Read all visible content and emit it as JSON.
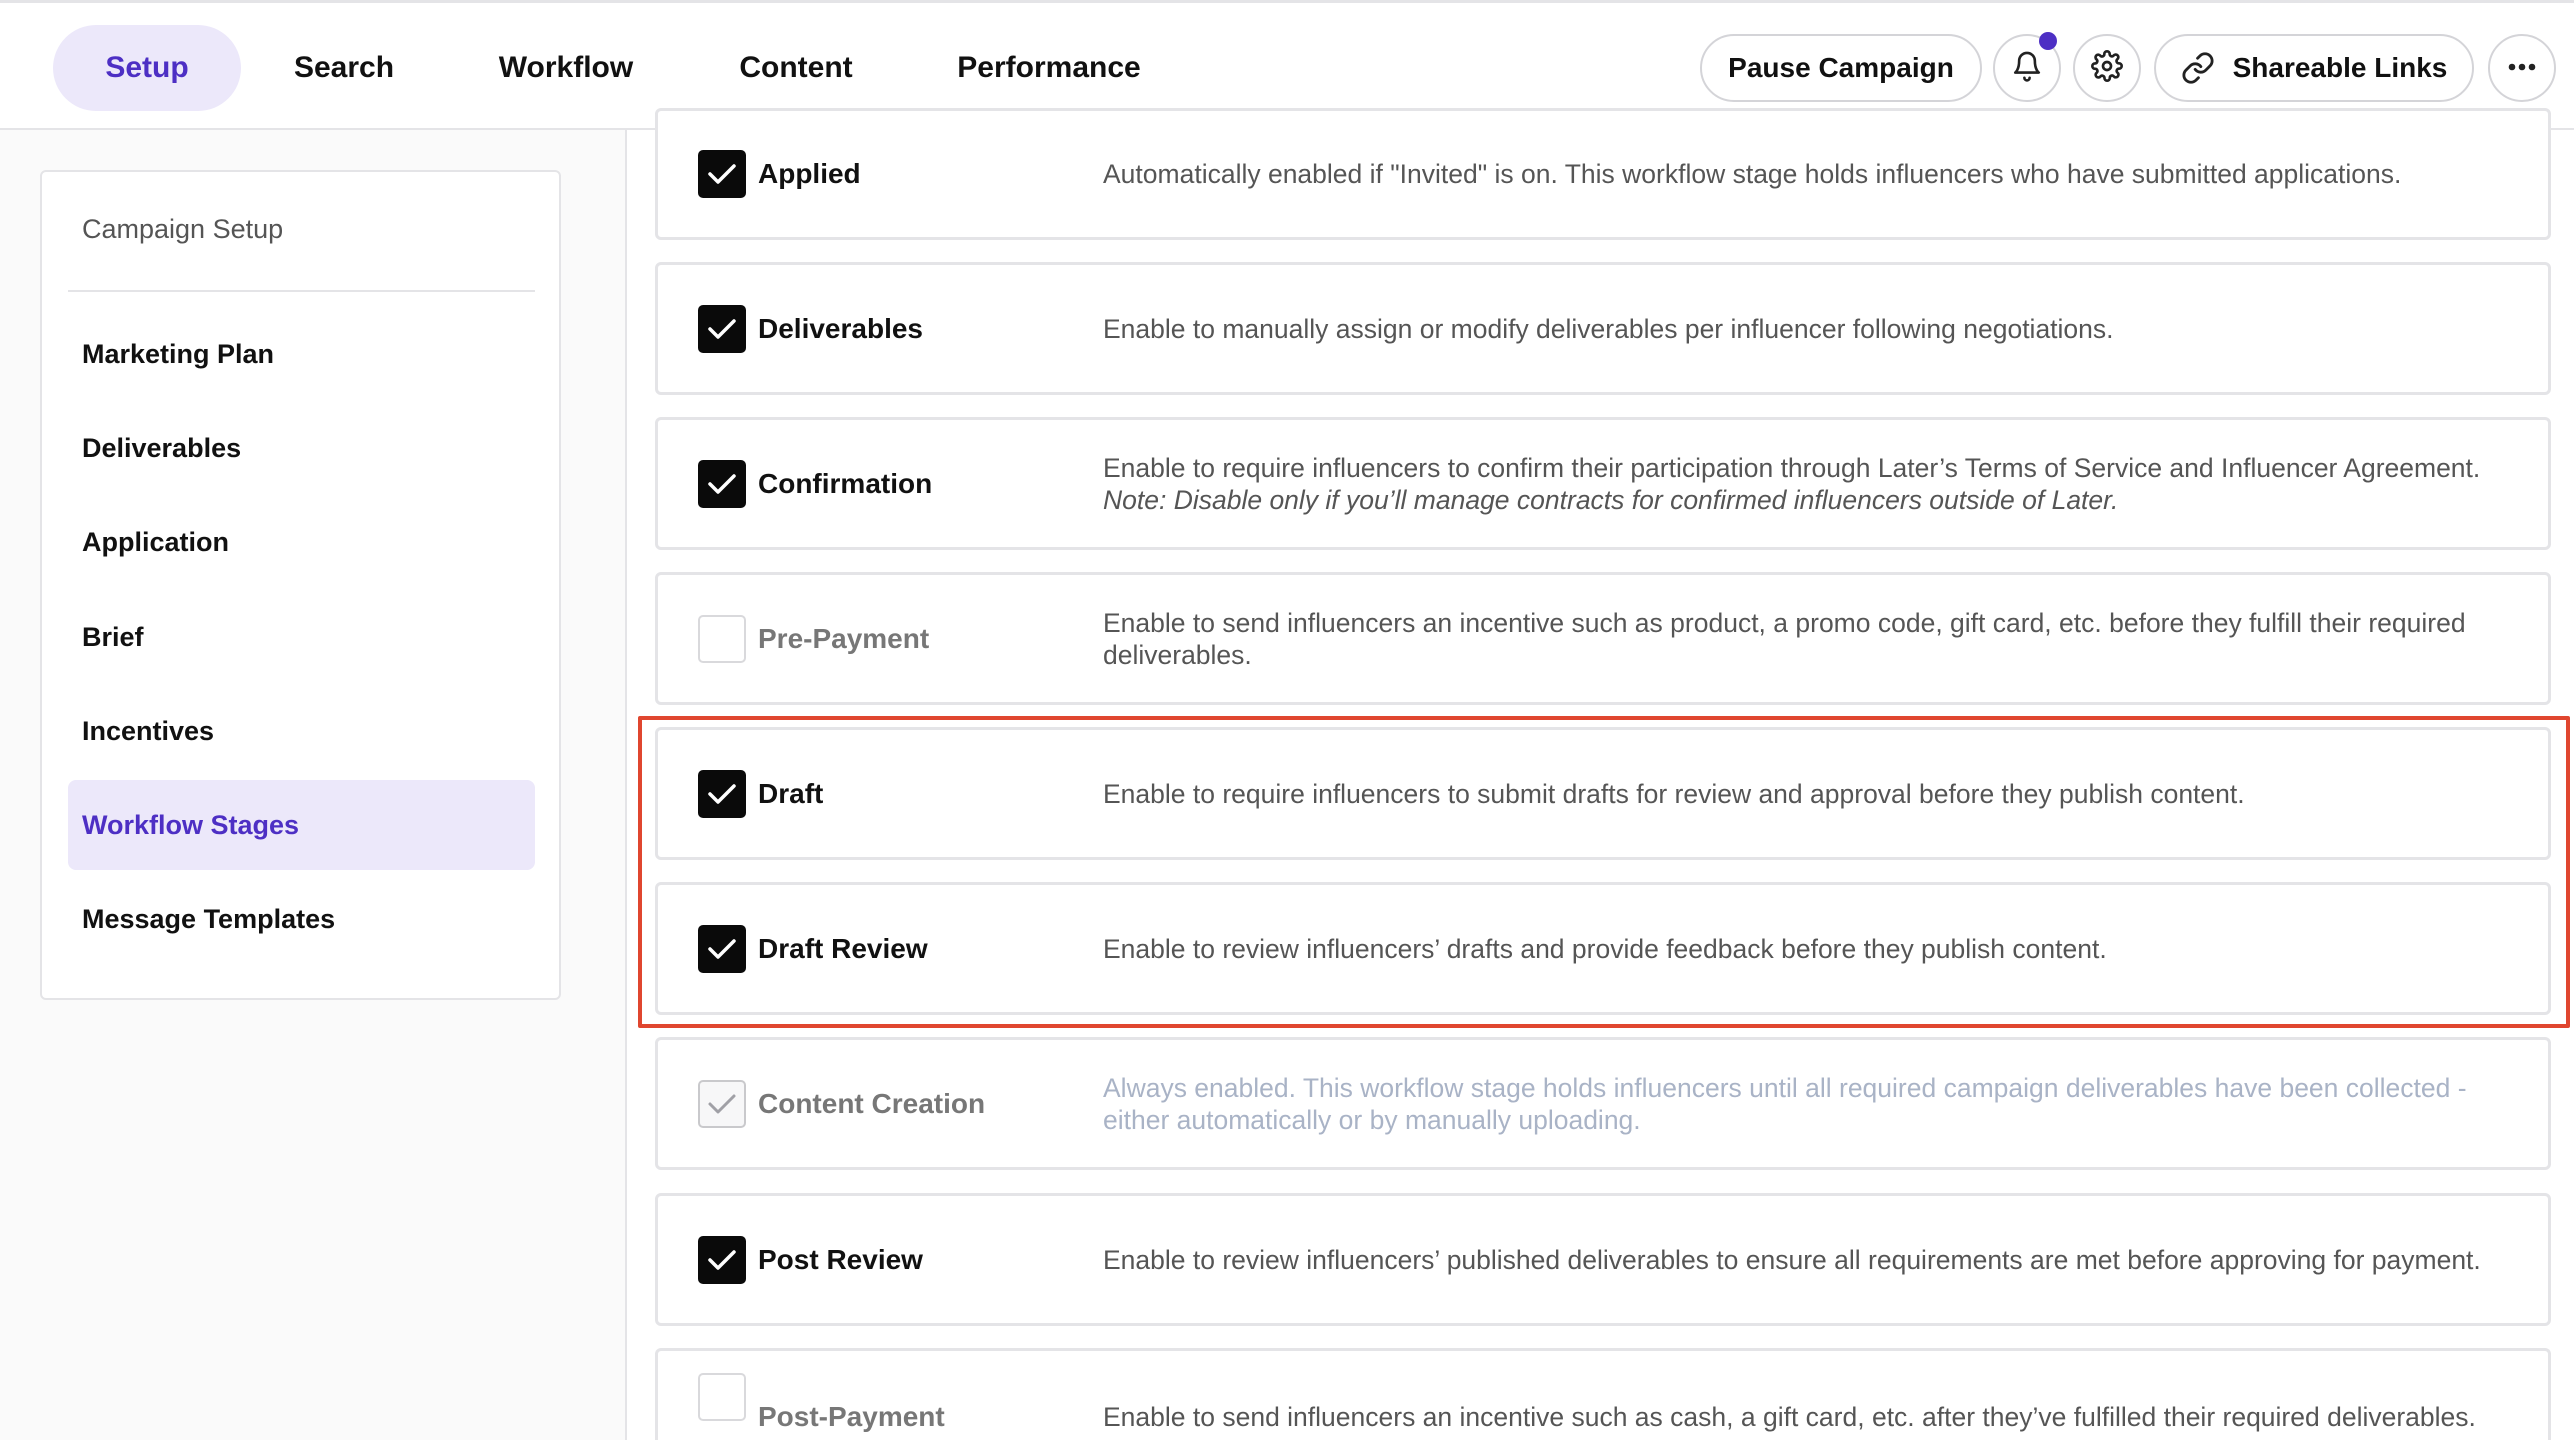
{
  "header": {
    "tabs": [
      {
        "label": "Setup"
      },
      {
        "label": "Search"
      },
      {
        "label": "Workflow"
      },
      {
        "label": "Content"
      },
      {
        "label": "Performance"
      }
    ],
    "pause_label": "Pause Campaign",
    "share_label": "Shareable Links",
    "icons": {
      "notifications": "bell-icon",
      "settings": "gear-icon",
      "link": "link-icon",
      "more": "more-icon"
    },
    "accent_color": "#4d2fc4"
  },
  "sidebar": {
    "title": "Campaign Setup",
    "items": [
      {
        "label": "Marketing Plan"
      },
      {
        "label": "Deliverables"
      },
      {
        "label": "Application"
      },
      {
        "label": "Brief"
      },
      {
        "label": "Incentives"
      },
      {
        "label": "Workflow Stages",
        "active": true
      },
      {
        "label": "Message Templates"
      }
    ]
  },
  "stages": [
    {
      "name": "Applied",
      "state": "checked",
      "desc": "Automatically enabled if \"Invited\" is on. This workflow stage holds influencers who have submitted applications."
    },
    {
      "name": "Deliverables",
      "state": "checked",
      "desc": "Enable to manually assign or modify deliverables per influencer following negotiations."
    },
    {
      "name": "Confirmation",
      "state": "checked",
      "desc": "Enable to require influencers to confirm their participation through Later’s Terms of Service and Influencer Agreement.",
      "note": "Note: Disable only if you’ll manage contracts for confirmed influencers outside of Later."
    },
    {
      "name": "Pre-Payment",
      "state": "unchecked",
      "desc": "Enable to send influencers an incentive such as product, a promo code, gift card, etc. before they fulfill their required deliverables."
    },
    {
      "name": "Draft",
      "state": "checked",
      "desc": "Enable to require influencers to submit drafts for review and approval before they publish content."
    },
    {
      "name": "Draft Review",
      "state": "checked",
      "desc": "Enable to review influencers’ drafts and provide feedback before they publish content."
    },
    {
      "name": "Content Creation",
      "state": "locked",
      "desc": "Always enabled. This workflow stage holds influencers until all required campaign deliverables have been collected - either automatically or by manually uploading."
    },
    {
      "name": "Post Review",
      "state": "checked",
      "desc": "Enable to review influencers’ published deliverables to ensure all requirements are met before approving for payment."
    },
    {
      "name": "Post-Payment",
      "state": "unchecked",
      "desc": "Enable to send influencers an incentive such as cash, a gift card, etc. after they’ve fulfilled their required deliverables."
    }
  ],
  "highlight_color": "#e0462f"
}
